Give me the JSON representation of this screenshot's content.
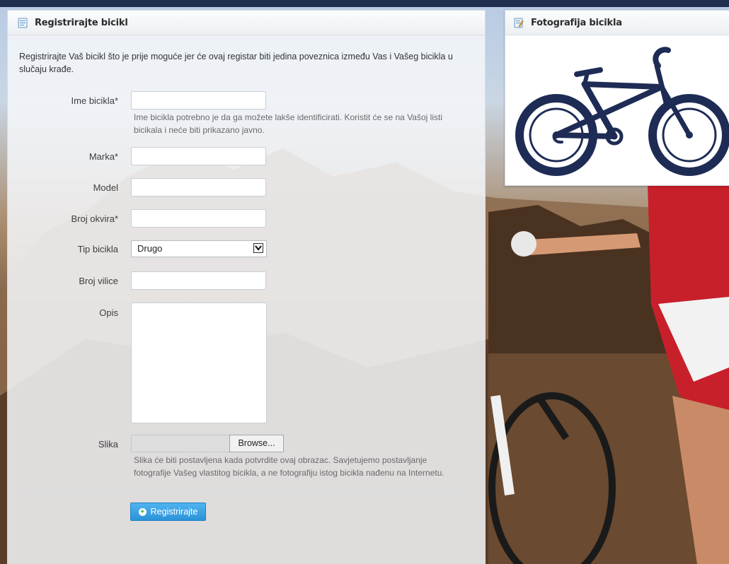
{
  "left_panel": {
    "title": "Registrirajte bicikl",
    "intro": "Registrirajte Vaš bicikl što je prije moguće jer će ovaj registar biti jedina poveznica između Vas i Vašeg bicikla u slučaju krađe."
  },
  "form": {
    "name": {
      "label": "Ime bicikla*",
      "value": "",
      "help_line1": "Ime bicikla potrebno je da ga možete lakše identificirati. Koristit će se na Vašoj listi",
      "help_line2": "bicikala i neće biti prikazano javno."
    },
    "brand": {
      "label": "Marka*",
      "value": ""
    },
    "model": {
      "label": "Model",
      "value": ""
    },
    "frame": {
      "label": "Broj okvira*",
      "value": ""
    },
    "type": {
      "label": "Tip bicikla",
      "selected": "Drugo"
    },
    "fork": {
      "label": "Broj vilice",
      "value": ""
    },
    "description": {
      "label": "Opis",
      "value": ""
    },
    "image": {
      "label": "Slika",
      "browse_label": "Browse...",
      "help_line1": "Slika će biti postavljena kada potvrdite ovaj obrazac. Savjetujemo postavljanje",
      "help_line2": "fotografije Vašeg vlastitog bicikla, a ne fotografiju istog bicikla nađenu na Internetu."
    },
    "submit_label": "Registrirajte"
  },
  "right_panel": {
    "title": "Fotografija bicikla"
  },
  "colors": {
    "accent": "#2b93d8",
    "bike_illustration": "#1e2c55"
  }
}
